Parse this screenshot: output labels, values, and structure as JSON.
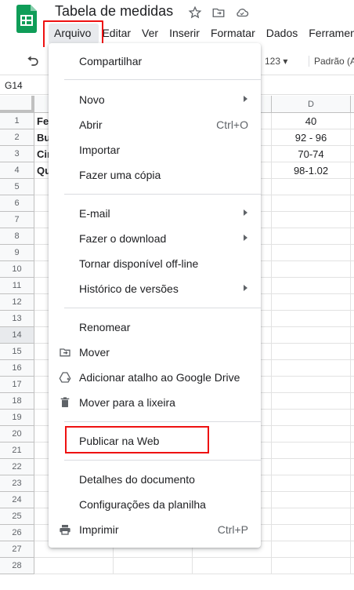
{
  "header": {
    "doc_title": "Tabela de medidas",
    "menu": [
      "Arquivo",
      "Editar",
      "Ver",
      "Inserir",
      "Formatar",
      "Dados",
      "Ferramentas"
    ]
  },
  "toolbar": {
    "number_format": "123",
    "font": "Padrão (Ar"
  },
  "namebox": {
    "value": "G14"
  },
  "grid": {
    "col_d": "D",
    "rows": [
      {
        "n": "1",
        "a": "Fe",
        "d": "40"
      },
      {
        "n": "2",
        "a": "Bu",
        "d": "92 - 96"
      },
      {
        "n": "3",
        "a": "Cin",
        "d": "70-74"
      },
      {
        "n": "4",
        "a": "Qu",
        "d": "98-1.02"
      },
      {
        "n": "5"
      },
      {
        "n": "6"
      },
      {
        "n": "7"
      },
      {
        "n": "8"
      },
      {
        "n": "9"
      },
      {
        "n": "10"
      },
      {
        "n": "11"
      },
      {
        "n": "12"
      },
      {
        "n": "13"
      },
      {
        "n": "14"
      },
      {
        "n": "15"
      },
      {
        "n": "16"
      },
      {
        "n": "17"
      },
      {
        "n": "18"
      },
      {
        "n": "19"
      },
      {
        "n": "20"
      },
      {
        "n": "21"
      },
      {
        "n": "22"
      },
      {
        "n": "23"
      },
      {
        "n": "24"
      },
      {
        "n": "25"
      },
      {
        "n": "26"
      },
      {
        "n": "27"
      },
      {
        "n": "28"
      }
    ]
  },
  "file_menu": {
    "share": "Compartilhar",
    "new": "Novo",
    "open": "Abrir",
    "open_shortcut": "Ctrl+O",
    "import": "Importar",
    "copy": "Fazer uma cópia",
    "email": "E-mail",
    "download": "Fazer o download",
    "offline": "Tornar disponível off-line",
    "history": "Histórico de versões",
    "rename": "Renomear",
    "move": "Mover",
    "shortcut": "Adicionar atalho ao Google Drive",
    "trash": "Mover para a lixeira",
    "publish": "Publicar na Web",
    "details": "Detalhes do documento",
    "settings": "Configurações da planilha",
    "print": "Imprimir",
    "print_shortcut": "Ctrl+P"
  },
  "colors": {
    "accent_red": "#ee1111",
    "sheets_green": "#0f9d58"
  }
}
